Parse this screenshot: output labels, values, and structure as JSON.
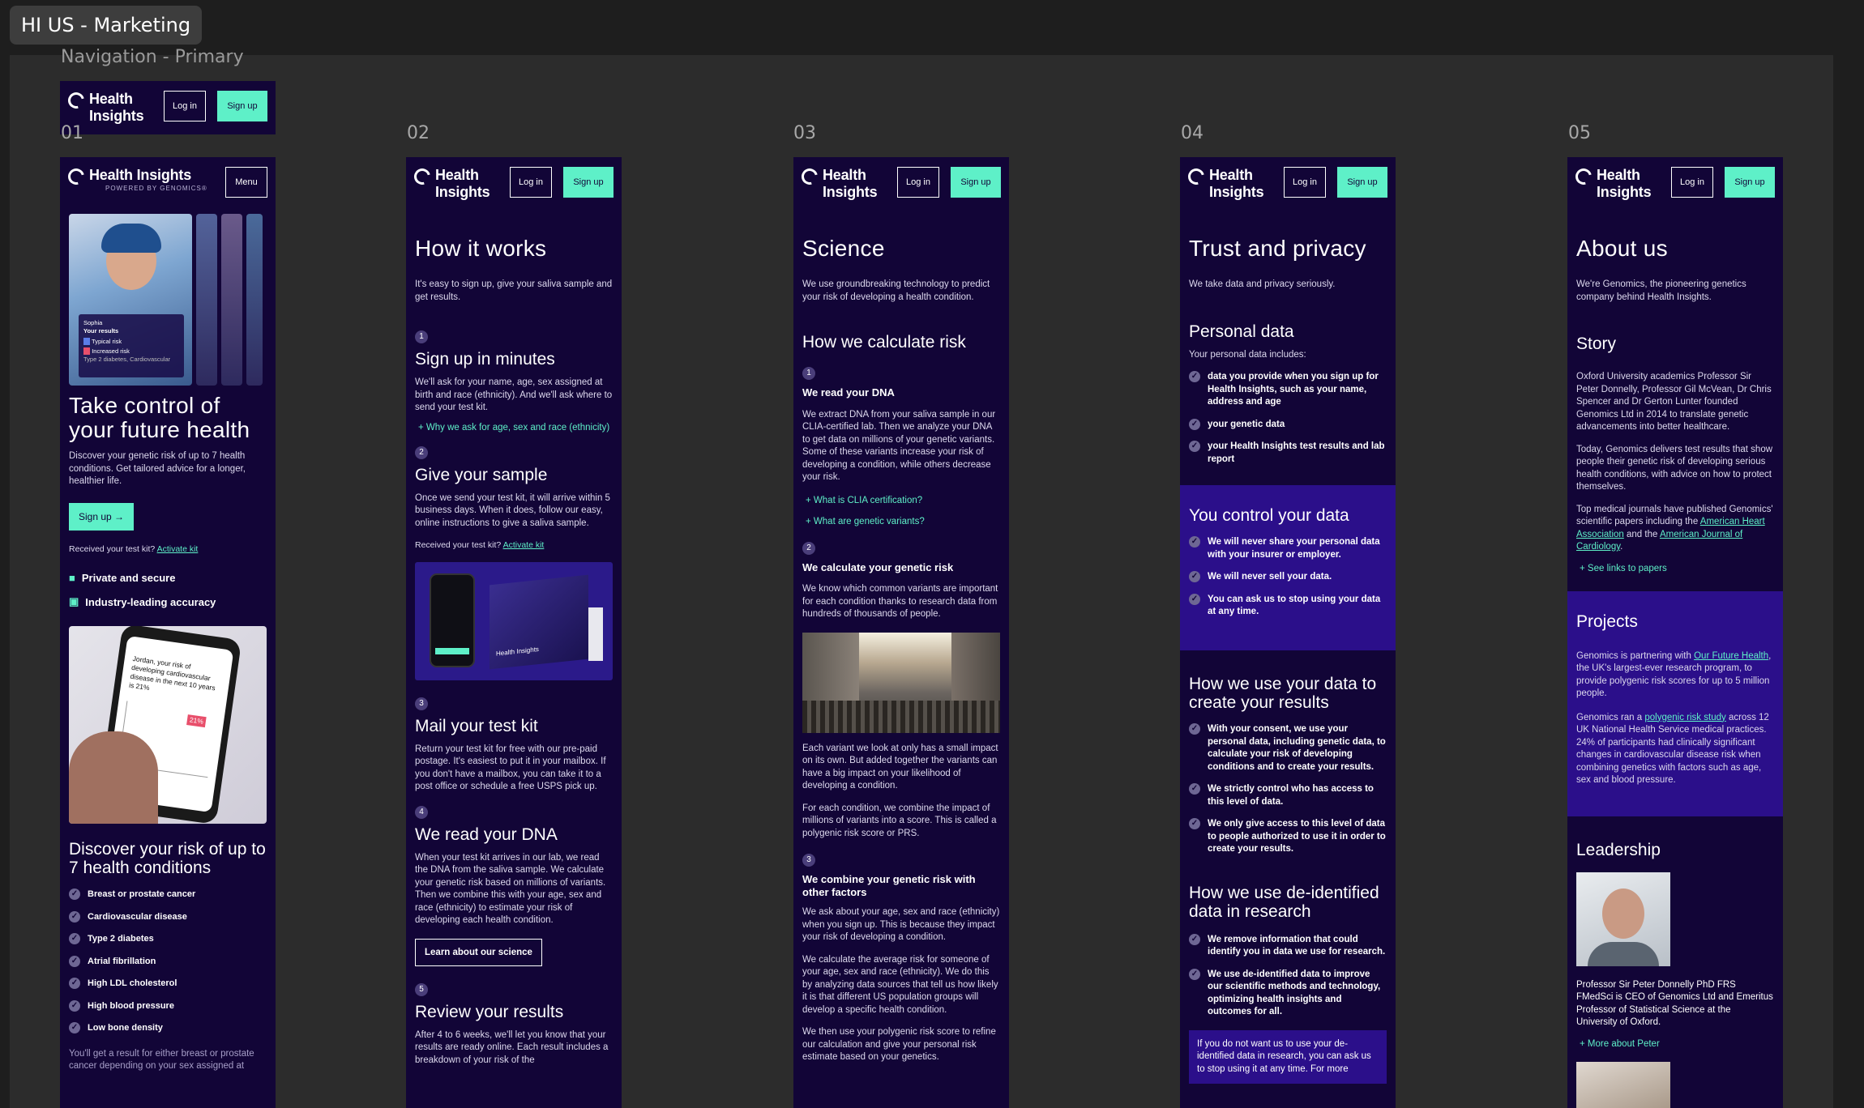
{
  "canvas_title": "HI US - Marketing",
  "nav_section_label": "Navigation - Primary",
  "brand": {
    "line1": "Health",
    "line2": "Insights",
    "full": "Health Insights",
    "powered": "POWERED BY GENOMICS®"
  },
  "buttons": {
    "login": "Log in",
    "signup": "Sign up",
    "menu": "Menu"
  },
  "columns": [
    "01",
    "02",
    "03",
    "04",
    "05"
  ],
  "home": {
    "card_name": "Sophia",
    "card_results": "Your results",
    "card_typical": "Typical risk",
    "card_increased": "Increased risk",
    "card_conditions": "Type 2 diabetes, Cardiovascular",
    "title": "Take control of your future health",
    "intro": "Discover your genetic risk of up to 7 health conditions. Get tailored advice for a longer, healthier life.",
    "signup": "Sign up",
    "kit_text": "Received your test kit?",
    "kit_link": "Activate kit",
    "features": [
      "Private and secure",
      "Industry-leading accuracy"
    ],
    "phone_text": "Jordan, your risk of developing cardiovascular disease in the next 10 years is 21%",
    "phone_pct": "21%",
    "discover_title": "Discover your risk of up to 7 health conditions",
    "conditions": [
      "Breast or prostate cancer",
      "Cardiovascular disease",
      "Type 2 diabetes",
      "Atrial fibrillation",
      "High LDL cholesterol",
      "High blood pressure",
      "Low bone density"
    ],
    "footer": "You'll get a result for either breast or prostate cancer depending on your sex assigned at"
  },
  "how": {
    "title": "How it works",
    "intro": "It's easy to sign up, give your saliva sample and get results.",
    "steps": [
      {
        "n": "1",
        "title": "Sign up in minutes",
        "text": "We'll ask for your name, age, sex assigned at birth and race (ethnicity). And we'll ask where to send your test kit.",
        "link": "Why we ask for age, sex and race (ethnicity)"
      },
      {
        "n": "2",
        "title": "Give your sample",
        "text": "Once we send your test kit, it will arrive within 5 business days. When it does, follow our easy, online instructions to give a saliva sample.",
        "kit_text": "Received your test kit?",
        "kit_link": "Activate kit"
      },
      {
        "n": "3",
        "title": "Mail your test kit",
        "text": "Return your test kit for free with our pre-paid postage. It's easiest to put it in your mailbox. If you don't have a mailbox, you can take it to a post office or schedule a free USPS pick up."
      },
      {
        "n": "4",
        "title": "We read your DNA",
        "text": "When your test kit arrives in our lab, we read the DNA from the saliva sample. We calculate your genetic risk based on millions of variants. Then we combine this with your age, sex and race (ethnicity) to estimate your risk of developing each health condition.",
        "button": "Learn about our science"
      },
      {
        "n": "5",
        "title": "Review your results",
        "text": "After 4 to 6 weeks, we'll let you know that your results are ready online. Each result includes a breakdown of your risk of the"
      }
    ]
  },
  "science": {
    "title": "Science",
    "intro": "We use groundbreaking technology to predict your risk of developing a health condition.",
    "calc_title": "How we calculate risk",
    "s1": {
      "n": "1",
      "title": "We read your DNA",
      "text": "We extract DNA from your saliva sample in our CLIA-certified lab. Then we analyze your DNA to get data on millions of your genetic variants. Some of these variants increase your risk of developing a condition, while others decrease your risk.",
      "links": [
        "What is CLIA certification?",
        "What are genetic variants?"
      ]
    },
    "s2": {
      "n": "2",
      "title": "We calculate your genetic risk",
      "text": "We know which common variants are important for each condition thanks to research data from hundreds of thousands of people.",
      "text2": "Each variant we look at only has a small impact on its own. But added together the variants can have a big impact on your likelihood of developing a condition.",
      "text3": "For each condition, we combine the impact of millions of variants into a score. This is called a polygenic risk score or PRS."
    },
    "s3": {
      "n": "3",
      "title": "We combine your genetic risk with other factors",
      "text": "We ask about your age, sex and race (ethnicity) when you sign up. This is because they impact your risk of developing a condition.",
      "text2": "We calculate the average risk for someone of your age, sex and race (ethnicity). We do this by analyzing data sources that tell us how likely it is that different US population groups will develop a specific health condition.",
      "text3": "We then use your polygenic risk score to refine our calculation and give your personal risk estimate based on your genetics."
    }
  },
  "trust": {
    "title": "Trust and privacy",
    "intro": "We take data and privacy seriously.",
    "personal_title": "Personal data",
    "personal_intro": "Your personal data includes:",
    "personal_items": [
      "data you provide when you sign up for Health Insights, such as your name, address and age",
      "your genetic data",
      "your Health Insights test results and lab report"
    ],
    "control_title": "You control your data",
    "control_items": [
      "We will never share your personal data with your insurer or employer.",
      "We will never sell your data.",
      "You can ask us to stop using your data at any time."
    ],
    "use_title": "How we use your data to create your results",
    "use_items": [
      "With your consent, we use your personal data, including genetic data, to calculate your risk of developing conditions and to create your results.",
      "We strictly control who has access to this level of data.",
      "We only give access to this level of data to people authorized to use it in order to create your results."
    ],
    "deid_title": "How we use de-identified data in research",
    "deid_items": [
      "We remove information that could identify you in data we use for research.",
      "We use de-identified data to improve our scientific methods and technology, optimizing health insights and outcomes for all."
    ],
    "notice": "If you do not want us to use your de-identified data in research, you can ask us to stop using it at any time. For more"
  },
  "about": {
    "title": "About us",
    "intro": "We're Genomics, the pioneering genetics company behind Health Insights.",
    "story_title": "Story",
    "story1": "Oxford University academics Professor Sir Peter Donnelly, Professor Gil McVean, Dr Chris Spencer and Dr Gerton Lunter founded Genomics Ltd in 2014 to translate genetic advancements into better healthcare.",
    "story2": "Today, Genomics delivers test results that show people their genetic risk of developing serious health conditions, with advice on how to protect themselves.",
    "story3a": "Top medical journals have published Genomics' scientific papers including the",
    "story3_link1": "American Heart Association",
    "story3_and": "and the",
    "story3_link2": "American Journal of Cardiology",
    "story3_end": ".",
    "papers_link": "See links to papers",
    "projects_title": "Projects",
    "proj1a": "Genomics is partnering with",
    "proj1_link": "Our Future Health",
    "proj1b": ", the UK's largest-ever research program, to provide polygenic risk scores for up to 5 million people.",
    "proj2a": "Genomics ran a",
    "proj2_link": "polygenic risk study",
    "proj2b": "across 12 UK National Health Service medical practices. 24% of participants had clinically significant changes in cardiovascular disease risk when combining genetics with factors such as age, sex and blood pressure.",
    "leadership_title": "Leadership",
    "leader_text": "Professor Sir Peter Donnelly PhD FRS FMedSci is CEO of Genomics Ltd and Emeritus Professor of Statistical Science at the University of Oxford.",
    "leader_link": "More about Peter"
  },
  "colors": {
    "bg": "#120537",
    "accent": "#5ef0c8",
    "band": "#2b0f8a"
  }
}
